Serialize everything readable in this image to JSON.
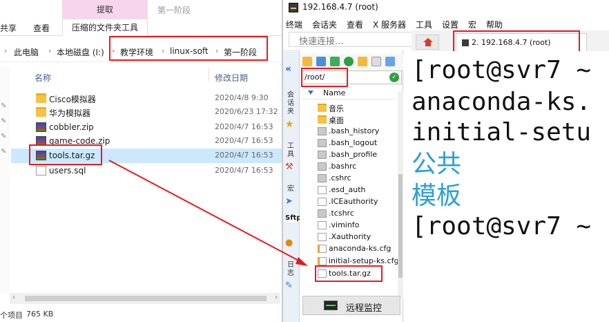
{
  "explorer": {
    "ribbon": {
      "context_tab": "提取",
      "context_stage": "第一阶段",
      "tabs": [
        "共享",
        "查看",
        "压缩的文件夹工具"
      ]
    },
    "breadcrumb": [
      "此电脑",
      "本地磁盘 (I:)",
      "教学环境",
      "linux-soft",
      "第一阶段"
    ],
    "columns": {
      "name": "名称",
      "date": "修改日期"
    },
    "files": [
      {
        "name": "Cisco模拟器",
        "date": "2020/4/8 9:30",
        "icon": "folder-icon"
      },
      {
        "name": "华为模拟器",
        "date": "2020/6/23 17:32",
        "icon": "folder-icon"
      },
      {
        "name": "cobbler.zip",
        "date": "2020/4/7 16:53",
        "icon": "archive-icon"
      },
      {
        "name": "game-code.zip",
        "date": "2020/4/7 16:53",
        "icon": "archive-icon"
      },
      {
        "name": "tools.tar.gz",
        "date": "2020/4/7 16:53",
        "icon": "archive-icon",
        "selected": true
      },
      {
        "name": "users.sql",
        "date": "2020/4/7 16:53",
        "icon": "file-icon"
      }
    ],
    "status": {
      "left": "个项目",
      "size": "765 KB"
    }
  },
  "xshell": {
    "title": "192.168.4.7 (root)",
    "menu": [
      "终端",
      "会话夹",
      "查看",
      "X 服务器",
      "工具",
      "设置",
      "宏",
      "帮助"
    ],
    "quick_connect_placeholder": "快速连接...",
    "session_tab": "2. 192.168.4.7 (root)",
    "vertical_labels": {
      "sessions": "会话夹",
      "tools": "工具",
      "macros": "宏",
      "sftp": "Sftp",
      "log": "日志"
    },
    "sftp": {
      "path": "/root/",
      "column": "Name",
      "entries": [
        {
          "name": "音乐",
          "type": "folder"
        },
        {
          "name": "桌面",
          "type": "folder"
        },
        {
          "name": ".bash_history",
          "type": "hidden"
        },
        {
          "name": ".bash_logout",
          "type": "hidden"
        },
        {
          "name": ".bash_profile",
          "type": "hidden"
        },
        {
          "name": ".bashrc",
          "type": "hidden"
        },
        {
          "name": ".cshrc",
          "type": "hidden"
        },
        {
          "name": ".esd_auth",
          "type": "file"
        },
        {
          "name": ".ICEauthority",
          "type": "file"
        },
        {
          "name": ".tcshrc",
          "type": "hidden"
        },
        {
          "name": ".viminfo",
          "type": "file"
        },
        {
          "name": ".Xauthority",
          "type": "file"
        },
        {
          "name": "anaconda-ks.cfg",
          "type": "cfg"
        },
        {
          "name": "initial-setup-ks.cfg",
          "type": "cfg"
        },
        {
          "name": "tools.tar.gz",
          "type": "tgz"
        }
      ],
      "monitor_button": "远程监控"
    },
    "terminal_lines": [
      {
        "text": "[root@svr7 ~",
        "style": "normal"
      },
      {
        "text": "anaconda-ks.",
        "style": "normal"
      },
      {
        "text": "initial-setu",
        "style": "normal"
      },
      {
        "text": "公共",
        "style": "cjk"
      },
      {
        "text": "模板",
        "style": "cjk"
      },
      {
        "text": "[root@svr7 ~",
        "style": "normal"
      }
    ]
  },
  "colors": {
    "annotation_red": "#e8191e",
    "selection_blue": "#cce8ff",
    "cjk_cyan": "#2aa0d8"
  }
}
